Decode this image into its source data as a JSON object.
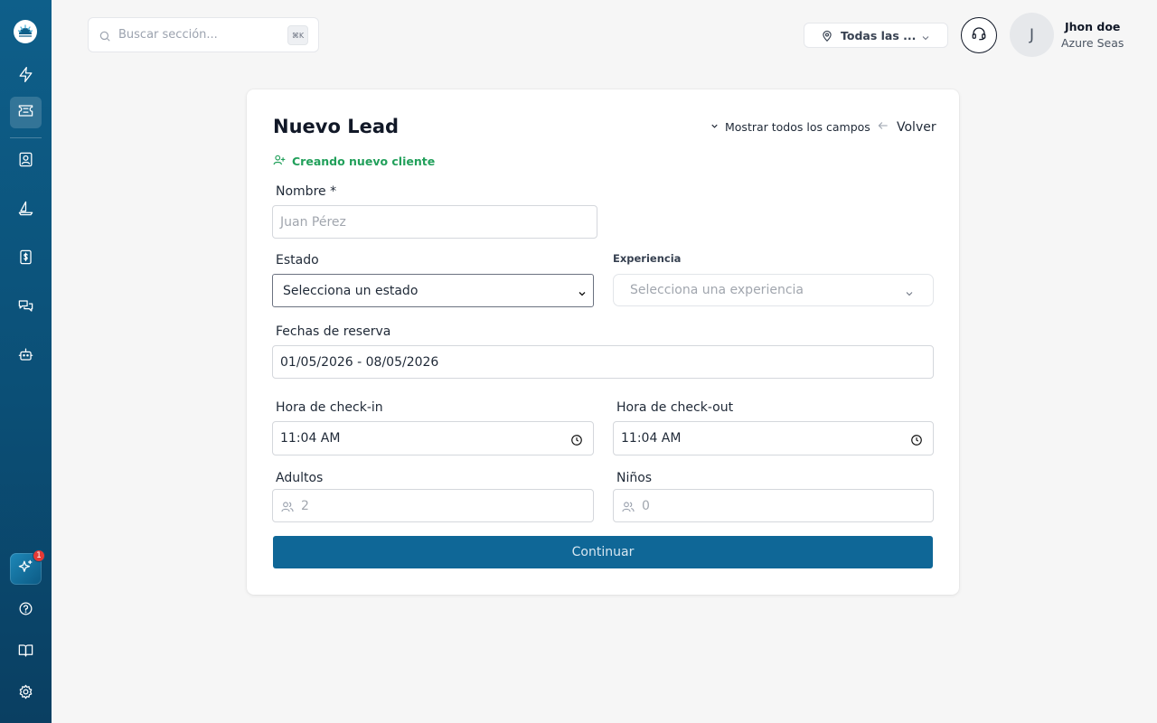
{
  "sidebar": {
    "logo_icon": "sunrise-logo-icon",
    "items": [
      {
        "name": "bolt-icon",
        "active": false
      },
      {
        "name": "ticket-icon",
        "active": true
      },
      {
        "name": "contact-card-icon",
        "active": false
      },
      {
        "name": "sailboat-icon",
        "active": false
      },
      {
        "name": "dollar-receipt-icon",
        "active": false
      },
      {
        "name": "chat-icon",
        "active": false
      },
      {
        "name": "robot-icon",
        "active": false
      }
    ],
    "ai_badge_count": "1",
    "bottom_items": [
      "help-circle-icon",
      "book-icon",
      "settings-icon"
    ]
  },
  "header": {
    "search_placeholder": "Buscar sección...",
    "search_shortcut": "⌘K",
    "location_label": "Todas las ...",
    "user_initial": "J",
    "user_name": "Jhon doe",
    "user_org": "Azure Seas"
  },
  "form": {
    "title": "Nuevo Lead",
    "show_all_fields": "Mostrar todos los campos",
    "back": "Volver",
    "creating_client": "Creando nuevo cliente",
    "name_label": "Nombre *",
    "name_placeholder": "Juan Pérez",
    "state_label": "Estado",
    "state_value": "Selecciona un estado",
    "experience_label": "Experiencia",
    "experience_placeholder": "Selecciona una experiencia",
    "dates_label": "Fechas de reserva",
    "dates_value": "01/05/2026 - 08/05/2026",
    "checkin_label": "Hora de check-in",
    "checkin_value": "11:04 AM",
    "checkout_label": "Hora de check-out",
    "checkout_value": "11:04 AM",
    "adults_label": "Adultos",
    "adults_placeholder": "2",
    "children_label": "Niños",
    "children_placeholder": "0",
    "continue_label": "Continuar"
  },
  "colors": {
    "sidebar": "#0e5f8a",
    "primary_button": "#0f6797",
    "success_green": "#22a05b",
    "badge_red": "#e53935"
  }
}
